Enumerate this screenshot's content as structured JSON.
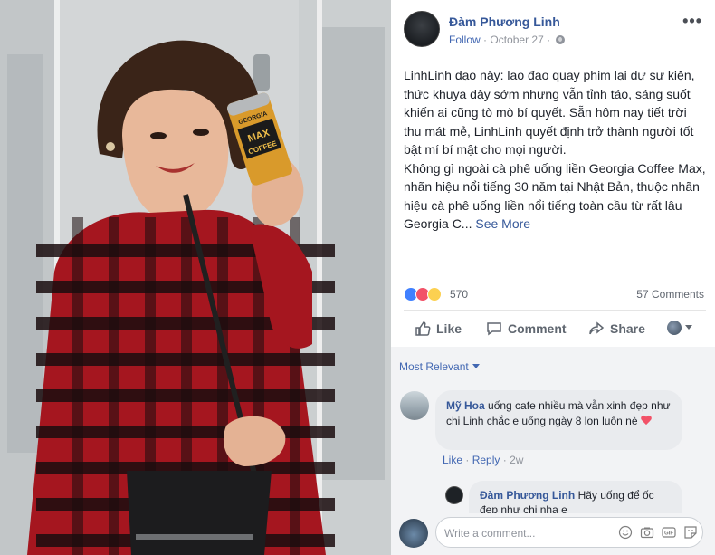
{
  "post": {
    "author": "Đàm Phương Linh",
    "follow_label": "Follow",
    "separator": "·",
    "date": "October 27",
    "date_sep": "·",
    "text_p1": "LinhLinh dạo này: lao đao quay phim lại dự sự kiện, thức khuya dậy sớm nhưng vẫn tỉnh táo, sáng suốt khiến ai cũng tò mò bí quyết. Sẵn hôm nay tiết trời thu mát mẻ, LinhLinh quyết định trở thành người tốt bật mí bí mật cho mọi người.",
    "text_p2": "Không gì ngoài cà phê uống liền Georgia Coffee Max, nhãn hiệu nổi tiếng 30 năm tại Nhật Bản, thuộc nhãn hiệu cà phê uống liền nổi tiếng toàn cầu từ rất lâu Georgia C...",
    "see_more": "See More"
  },
  "reactions": {
    "count": "570",
    "comments_count": "57 Comments",
    "icons": [
      "like-reaction-icon",
      "love-reaction-icon",
      "haha-reaction-icon"
    ],
    "colors": {
      "like": "#4080ff",
      "love": "#f25268",
      "haha": "#fcd050"
    }
  },
  "actions": {
    "like": "Like",
    "comment": "Comment",
    "share": "Share"
  },
  "comments": {
    "sort_label": "Most Relevant",
    "items": [
      {
        "name": "Mỹ Hoa",
        "text": "uống cafe nhiều mà vẫn xinh đẹp như chị Linh chắc e uống ngày 8 lon luôn nè",
        "like": "Like",
        "reply": "Reply",
        "dot": "·",
        "time": "2w"
      }
    ],
    "reply": {
      "name": "Đàm Phương Linh",
      "text": "Hãy uống để ốc đẹp như chị nha e"
    }
  },
  "composer": {
    "placeholder": "Write a comment..."
  },
  "photo": {
    "can_label_1": "GEORGIA",
    "can_label_2": "MAX",
    "can_label_3": "COFFEE"
  },
  "colors": {
    "link": "#365899",
    "accent": "#4267b2",
    "muted": "#90949c"
  }
}
